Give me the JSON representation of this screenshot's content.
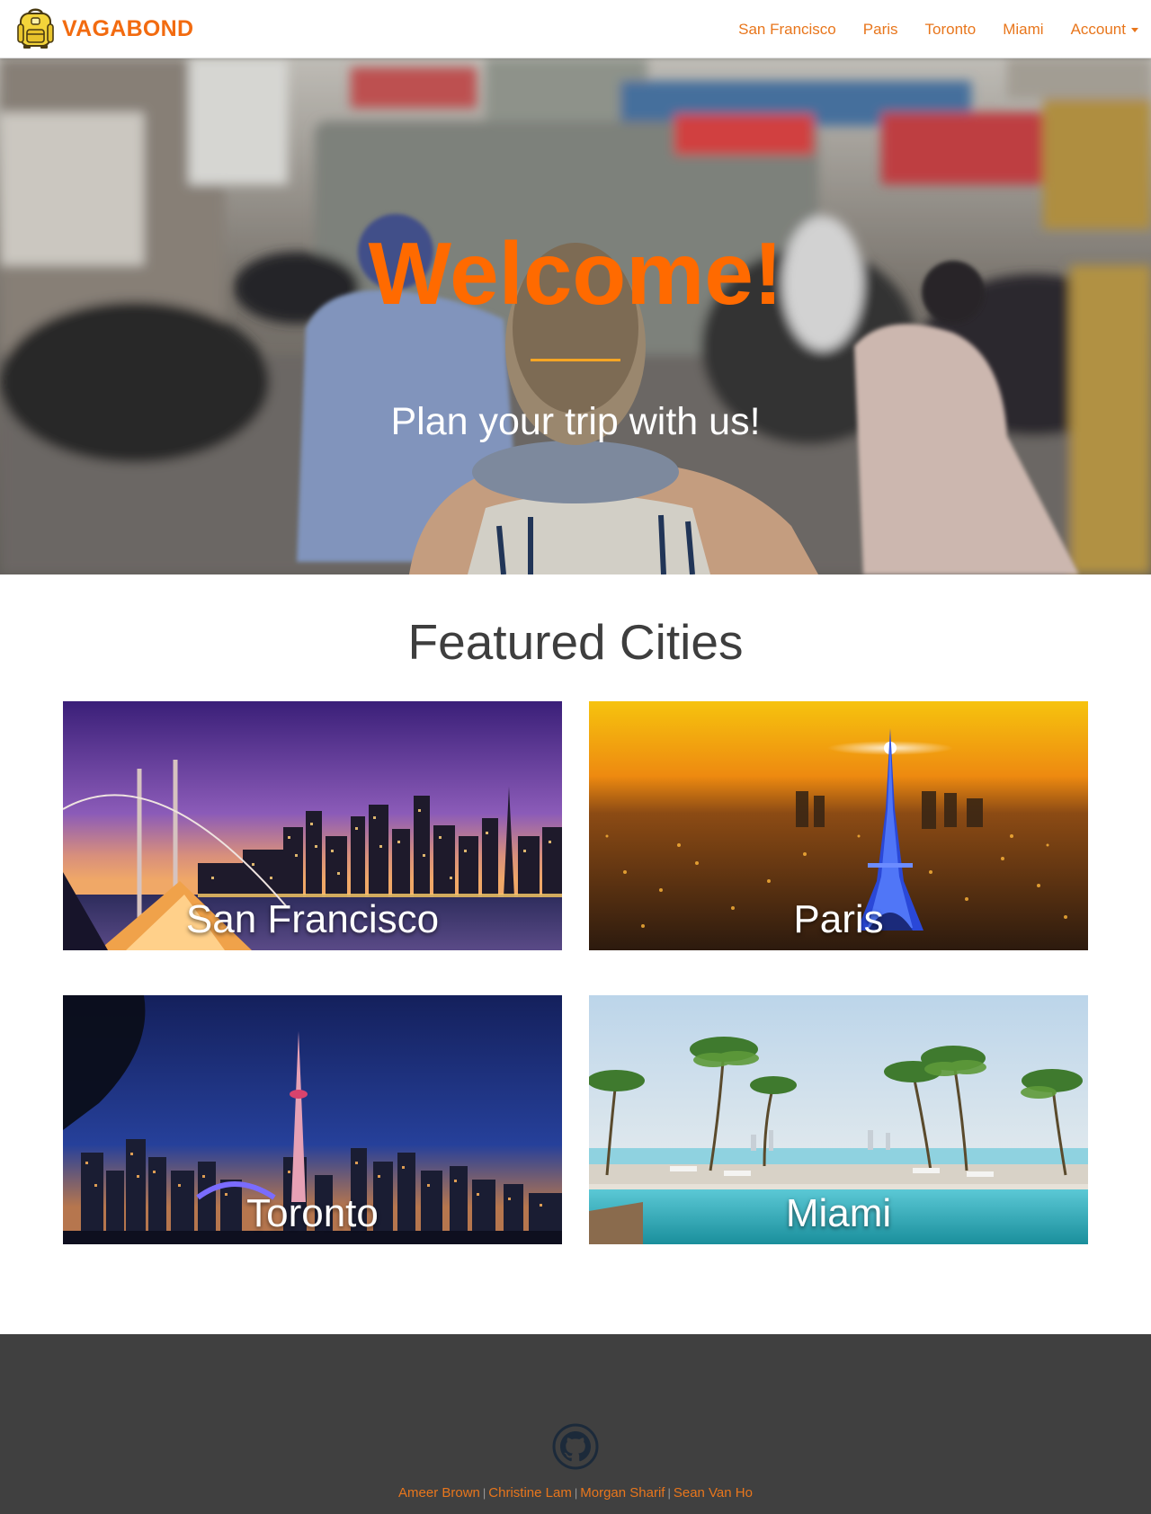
{
  "brand": {
    "name": "VAGABOND",
    "logo_icon": "backpack-icon",
    "accent_color": "#f26b10"
  },
  "nav": {
    "items": [
      {
        "label": "San Francisco"
      },
      {
        "label": "Paris"
      },
      {
        "label": "Toronto"
      },
      {
        "label": "Miami"
      }
    ],
    "account_label": "Account",
    "account_icon": "caret-down-icon"
  },
  "hero": {
    "title": "Welcome!",
    "subtitle": "Plan your trip with us!",
    "title_color": "#ff6a00",
    "rule_color": "#f5a524"
  },
  "featured": {
    "title": "Featured Cities",
    "cities": [
      {
        "name": "San Francisco"
      },
      {
        "name": "Paris"
      },
      {
        "name": "Toronto"
      },
      {
        "name": "Miami"
      }
    ]
  },
  "footer": {
    "icon": "github-icon",
    "authors": [
      "Ameer Brown",
      "Christine Lam",
      "Morgan Sharif",
      "Sean Van Ho"
    ],
    "separator": "|",
    "background": "#404040"
  }
}
